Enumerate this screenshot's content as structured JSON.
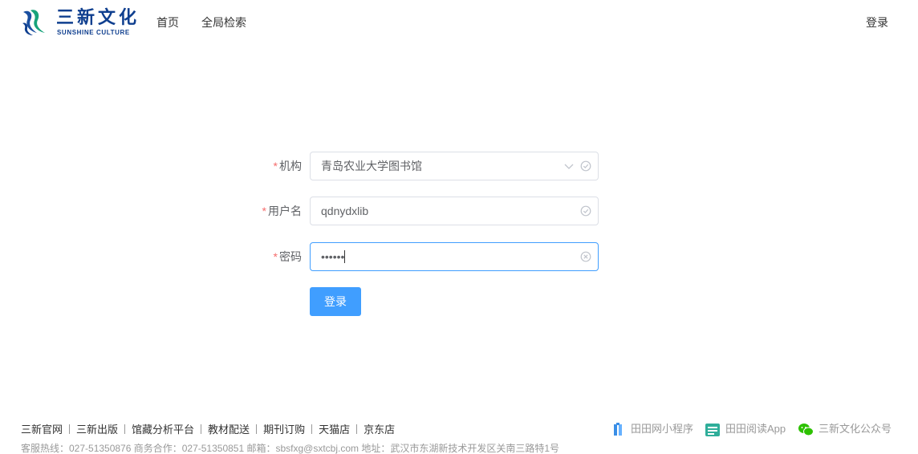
{
  "brand": {
    "name_cn": "三新文化",
    "name_en": "SUNSHINE CULTURE"
  },
  "nav": {
    "items": [
      {
        "label": "首页"
      },
      {
        "label": "全局检索"
      }
    ],
    "login": "登录"
  },
  "form": {
    "institution": {
      "label": "机构",
      "required_mark": "*",
      "value": "青岛农业大学图书馆"
    },
    "username": {
      "label": "用户名",
      "required_mark": "*",
      "value": "qdnydxlib"
    },
    "password": {
      "label": "密码",
      "required_mark": "*",
      "masked_value": "••••••"
    },
    "submit_label": "登录"
  },
  "footer": {
    "links": [
      "三新官网",
      "三新出版",
      "馆藏分析平台",
      "教材配送",
      "期刊订购",
      "天猫店",
      "京东店"
    ],
    "apps": [
      {
        "label": "田田网小程序",
        "icon": "mini-program-icon"
      },
      {
        "label": "田田阅读App",
        "icon": "reading-app-icon"
      },
      {
        "label": "三新文化公众号",
        "icon": "wechat-icon"
      }
    ],
    "contact_line": "客服热线：027-51350876    商务合作：027-51350851    邮箱：sbsfxg@sxtcbj.com    地址：武汉市东湖新技术开发区关南三路特1号"
  },
  "colors": {
    "brand": "#0f3f8f",
    "primary": "#409eff",
    "required": "#f56c6c",
    "valid": "#c0c4cc"
  }
}
